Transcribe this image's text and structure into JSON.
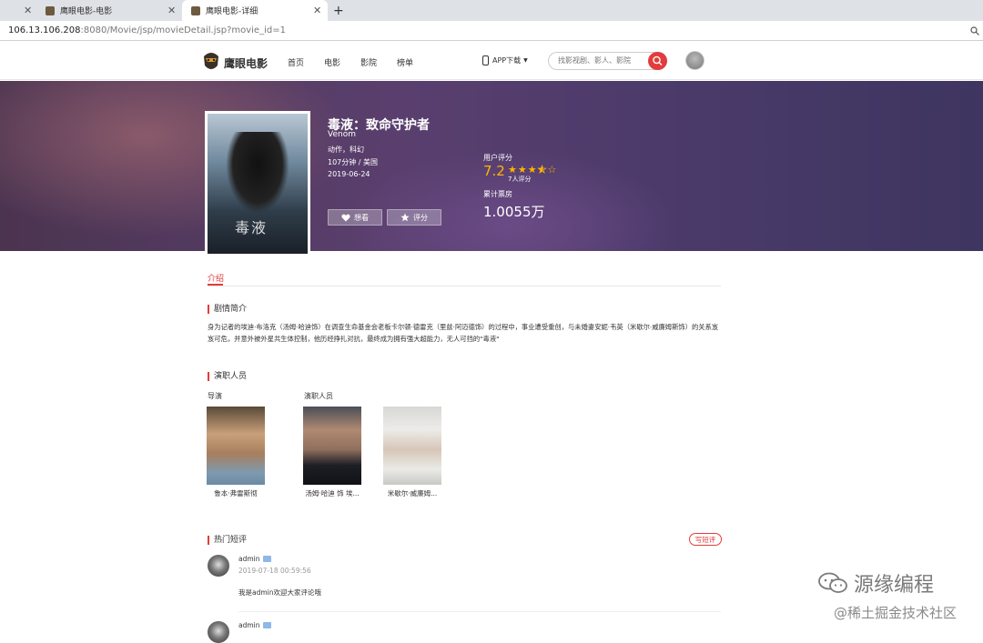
{
  "browser": {
    "tabs": [
      {
        "label": "",
        "active": false
      },
      {
        "label": "鹰眼电影-电影",
        "active": false
      },
      {
        "label": "鹰眼电影-详细",
        "active": true
      }
    ],
    "new_tab": "+",
    "url_host": "106.13.106.208",
    "url_path": ":8080/Movie/jsp/movieDetail.jsp?movie_id=1"
  },
  "header": {
    "logo": "鹰眼电影",
    "nav": [
      "首页",
      "电影",
      "影院",
      "榜单"
    ],
    "app_download": "APP下载",
    "search_placeholder": "找影视剧、影人、影院"
  },
  "movie": {
    "title": "毒液：致命守护者",
    "english_title": "Venom",
    "genres": "动作，科幻",
    "duration_country": "107分钟 / 美国",
    "release_date": "2019-06-24",
    "poster_text": "毒液",
    "want_button": "想看",
    "rate_button": "评分",
    "rating_label": "用户评分",
    "rating_score": "7.2",
    "rating_stars": 3.5,
    "rating_count": "7人评分",
    "boxoffice_label": "累计票房",
    "boxoffice_value": "1.0055万"
  },
  "content": {
    "tab_intro": "介绍",
    "synopsis_title": "剧情简介",
    "synopsis": "身为记者的埃迪·布洛克（汤姆·哈迪饰）在调查生命基金会老板卡尔顿·德雷克（里兹·阿迈德饰）的过程中，事业遭受重创，与未婚妻安妮·韦英（米歇尔·威廉姆斯饰）的关系岌岌可危，并意外被外星共生体控制，他历经挣扎对抗，最终成为拥有强大超能力，无人可挡的\"毒液\"",
    "cast_title": "演职人员",
    "director_label": "导演",
    "actors_label": "演职人员",
    "director_name": "鲁本·弗雷斯彻",
    "actor1_name": "汤姆·哈迪 饰 埃...",
    "actor2_name": "米歇尔·威廉姆...",
    "reviews_title": "热门短评",
    "write_review": "写短评"
  },
  "comments": [
    {
      "user": "admin",
      "time": "2019-07-18 00:59:56",
      "text": "我是admin欢迎大家评论哦"
    },
    {
      "user": "admin",
      "time": "",
      "text": ""
    }
  ],
  "watermark": {
    "line1": "源缘编程",
    "line2": "@稀土掘金技术社区"
  },
  "colors": {
    "accent": "#e23c3c",
    "star": "#ffb400"
  }
}
